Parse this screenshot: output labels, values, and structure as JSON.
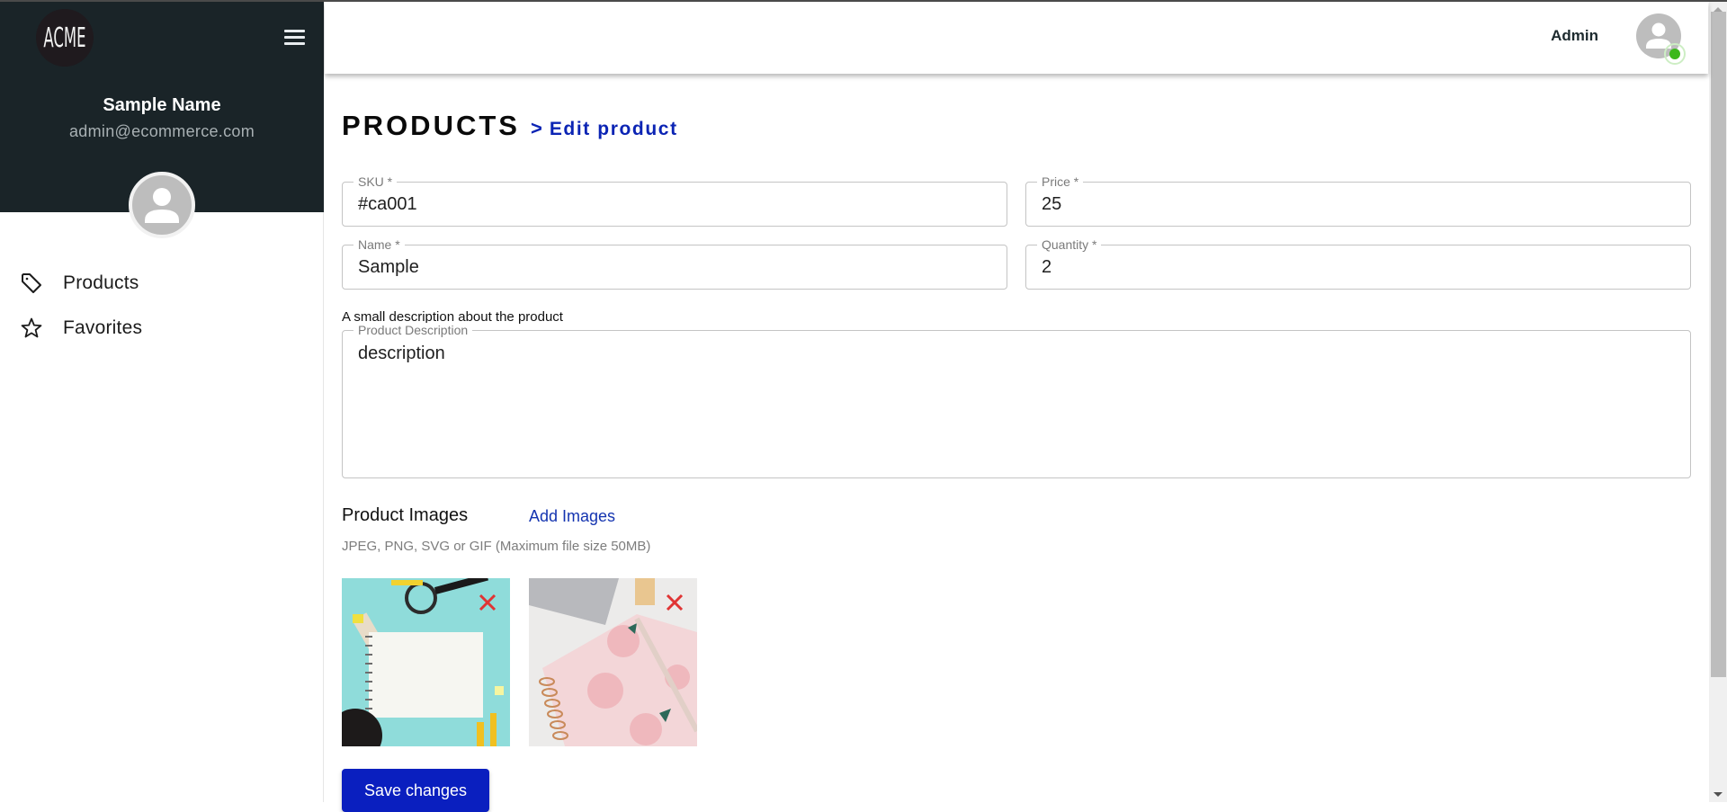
{
  "sidebar": {
    "logo_text": "ACME",
    "user_name": "Sample Name",
    "user_email": "admin@ecommerce.com",
    "nav": [
      {
        "label": "Products",
        "icon": "tag-icon"
      },
      {
        "label": "Favorites",
        "icon": "star-icon"
      }
    ]
  },
  "header": {
    "role_label": "Admin",
    "status": "online",
    "status_color": "#3cb81c"
  },
  "main": {
    "title": "PRODUCTS",
    "breadcrumb_separator": ">",
    "breadcrumb_current": "Edit product",
    "fields": {
      "sku": {
        "label": "SKU *",
        "value": "#ca001"
      },
      "price": {
        "label": "Price *",
        "value": "25"
      },
      "name": {
        "label": "Name *",
        "value": "Sample"
      },
      "quantity": {
        "label": "Quantity *",
        "value": "2"
      },
      "description": {
        "hint": "A small description about the product",
        "label": "Product Description",
        "value": "description"
      }
    },
    "images": {
      "title": "Product Images",
      "add_label": "Add Images",
      "hint": "JPEG, PNG, SVG or GIF (Maximum file size 50MB)",
      "items": [
        {
          "alt": "Notebook with stationery on teal background"
        },
        {
          "alt": "Floral planner with laptop"
        }
      ]
    },
    "save_label": "Save changes"
  },
  "colors": {
    "sidebar_dark": "#1a2428",
    "accent_blue": "#0b24b4",
    "button_blue": "#0a1fbf",
    "remove_red": "#e03434"
  }
}
